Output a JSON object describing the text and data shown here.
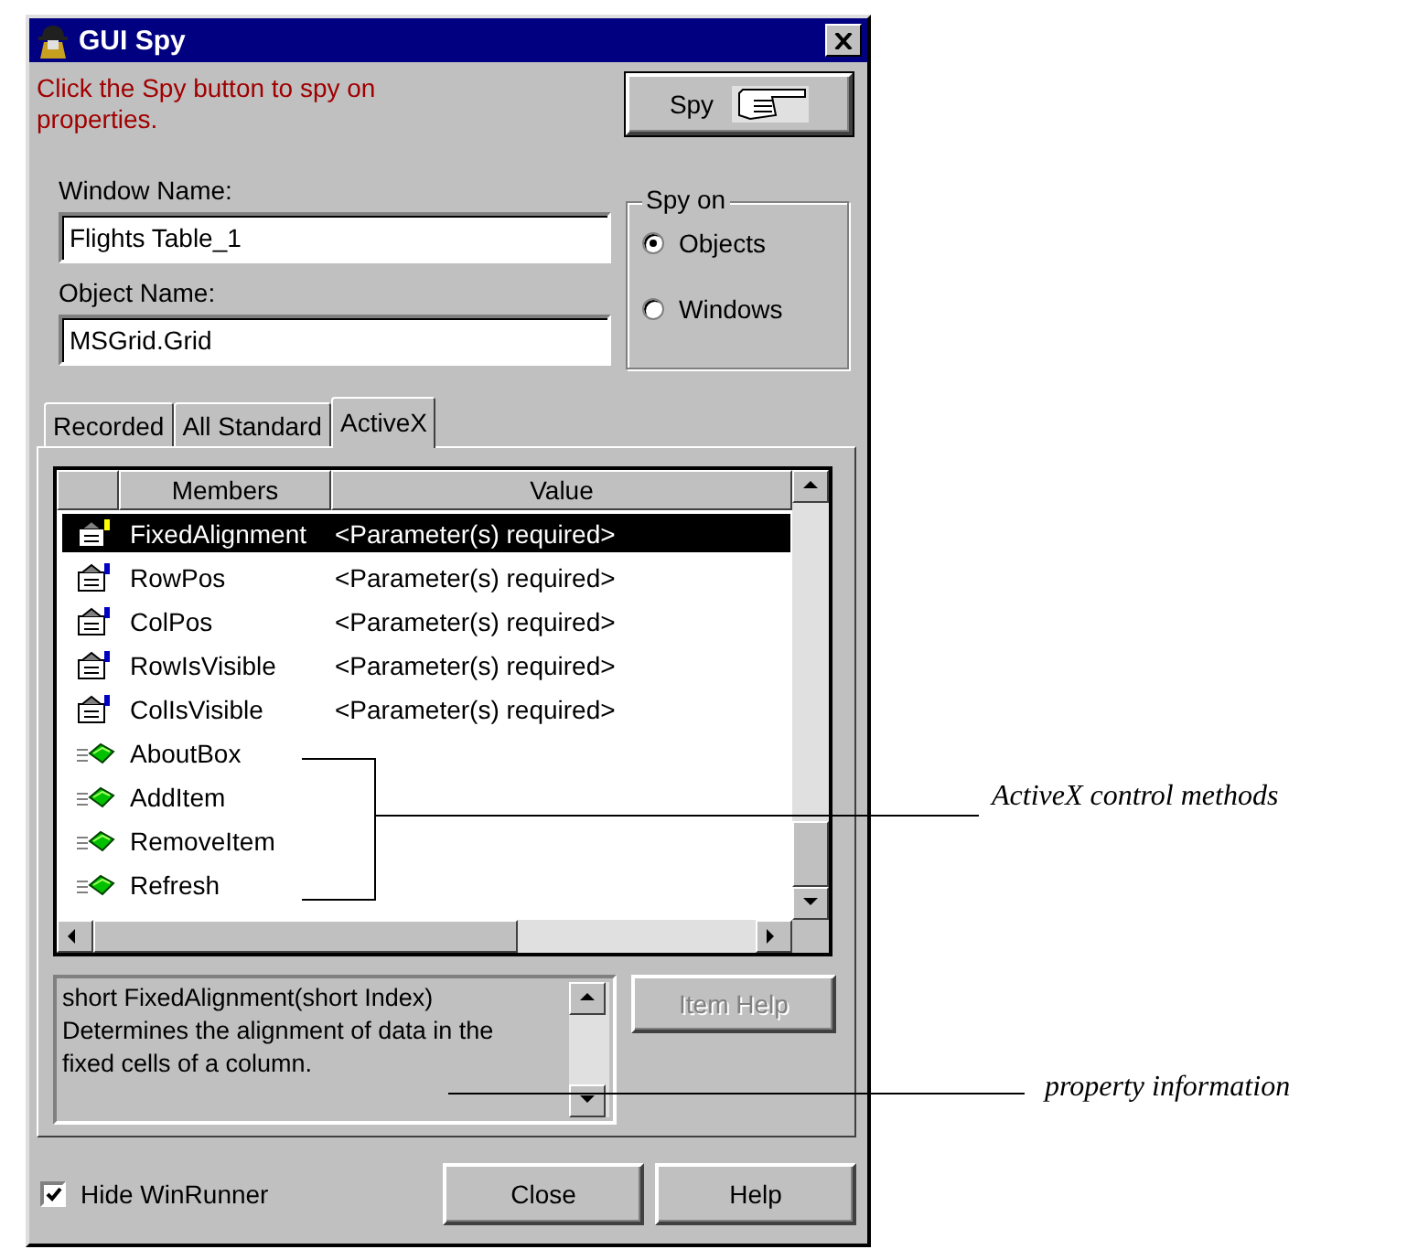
{
  "window": {
    "title": "GUI Spy"
  },
  "hint": "Click the Spy button to spy on properties.",
  "spy_button": {
    "label": "Spy"
  },
  "window_name": {
    "label": "Window Name:",
    "value": "Flights Table_1"
  },
  "object_name": {
    "label": "Object Name:",
    "value": "MSGrid.Grid"
  },
  "spy_on": {
    "title": "Spy on",
    "options": [
      {
        "label": "Objects",
        "selected": true
      },
      {
        "label": "Windows",
        "selected": false
      }
    ]
  },
  "tabs": [
    {
      "label": "Recorded",
      "selected": false
    },
    {
      "label": "All Standard",
      "selected": false
    },
    {
      "label": "ActiveX",
      "selected": true
    }
  ],
  "grid": {
    "columns": [
      "Members",
      "Value"
    ],
    "rows": [
      {
        "kind": "property",
        "member": "FixedAlignment",
        "value": "<Parameter(s) required>",
        "selected": true
      },
      {
        "kind": "property",
        "member": "RowPos",
        "value": "<Parameter(s) required>",
        "selected": false
      },
      {
        "kind": "property",
        "member": "ColPos",
        "value": "<Parameter(s) required>",
        "selected": false
      },
      {
        "kind": "property",
        "member": "RowIsVisible",
        "value": "<Parameter(s) required>",
        "selected": false
      },
      {
        "kind": "property",
        "member": "ColIsVisible",
        "value": "<Parameter(s) required>",
        "selected": false
      },
      {
        "kind": "method",
        "member": "AboutBox",
        "selected": false
      },
      {
        "kind": "method",
        "member": "AddItem",
        "selected": false
      },
      {
        "kind": "method",
        "member": "RemoveItem",
        "selected": false
      },
      {
        "kind": "method",
        "member": "Refresh",
        "selected": false
      }
    ]
  },
  "info": {
    "lines": [
      "short FixedAlignment(short Index)",
      "Determines the alignment of data in the fixed cells of a column."
    ]
  },
  "item_help_button": {
    "label": "Item Help",
    "disabled": true
  },
  "hide_winrunner": {
    "label": "Hide WinRunner",
    "checked": true
  },
  "buttons": [
    {
      "label": "Close"
    },
    {
      "label": "Help"
    }
  ],
  "callouts": [
    {
      "text": "ActiveX control methods"
    },
    {
      "text": "property information"
    }
  ]
}
